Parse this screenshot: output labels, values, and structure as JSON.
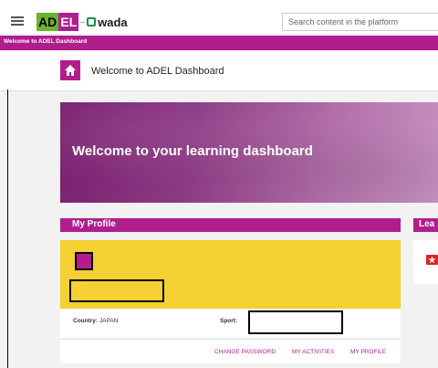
{
  "brand": {
    "logo_ad": "AD",
    "logo_el": "EL",
    "logo_dash": "–",
    "logo_wada": "wada"
  },
  "header": {
    "search_placeholder": "Search content in the platform"
  },
  "breadcrumb_bar": {
    "label": "Welcome to ADEL Dashboard"
  },
  "page": {
    "title": "Welcome to ADEL Dashboard"
  },
  "banner": {
    "headline": "Welcome to your learning dashboard"
  },
  "profile": {
    "section_title": "My Profile",
    "country_label": "Country:",
    "country_value": "JAPAN",
    "sport_label": "Sport:",
    "actions": {
      "change_password": "CHANGE PASSWORD",
      "my_activities": "MY ACTIVITIES",
      "my_profile": "MY PROFILE"
    }
  },
  "learning": {
    "section_title": "Lea"
  },
  "colors": {
    "brand_purple": "#b01e8e",
    "brand_green": "#6ab42d",
    "profile_yellow": "#f4d033"
  }
}
